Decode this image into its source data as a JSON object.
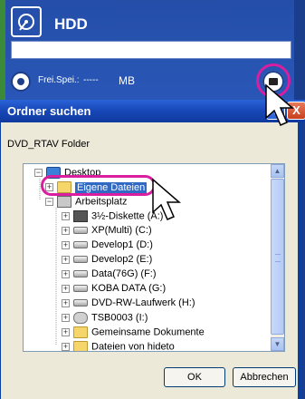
{
  "app": {
    "title": "HDD",
    "path_value": "",
    "free_space_label": "Frei.Spei.:",
    "free_space_value": "-----",
    "free_space_unit": "MB"
  },
  "dialog": {
    "title": "Ordner suchen",
    "help_label": "?",
    "close_label": "X",
    "folder_caption": "DVD_RTAV Folder",
    "tree": [
      {
        "label": "Desktop",
        "icon": "desktop-icon",
        "expander": "−"
      },
      {
        "label": "Eigene Dateien",
        "icon": "folder-icon",
        "expander": "+",
        "selected": true
      },
      {
        "label": "Arbeitsplatz",
        "icon": "computer-icon",
        "expander": "−"
      },
      {
        "label": "3½-Diskette (A:)",
        "icon": "floppy-icon",
        "expander": "+"
      },
      {
        "label": "XP(Multi) (C:)",
        "icon": "drive-icon",
        "expander": "+"
      },
      {
        "label": "Develop1 (D:)",
        "icon": "drive-icon",
        "expander": "+"
      },
      {
        "label": "Develop2 (E:)",
        "icon": "drive-icon",
        "expander": "+"
      },
      {
        "label": "Data(76G) (F:)",
        "icon": "drive-icon",
        "expander": "+"
      },
      {
        "label": "KOBA DATA (G:)",
        "icon": "drive-icon",
        "expander": "+"
      },
      {
        "label": "DVD-RW-Laufwerk (H:)",
        "icon": "dvd-drive-icon",
        "expander": "+"
      },
      {
        "label": "TSB0003 (I:)",
        "icon": "network-drive-icon",
        "expander": "+"
      },
      {
        "label": "Gemeinsame Dokumente",
        "icon": "folder-icon",
        "expander": "+"
      },
      {
        "label": "Dateien von hideto",
        "icon": "folder-icon",
        "expander": "+"
      }
    ],
    "ok_label": "OK",
    "cancel_label": "Abbrechen"
  },
  "colors": {
    "highlight": "#d91ea0",
    "titlebar": "#1746b6",
    "selection": "#316ac5"
  }
}
